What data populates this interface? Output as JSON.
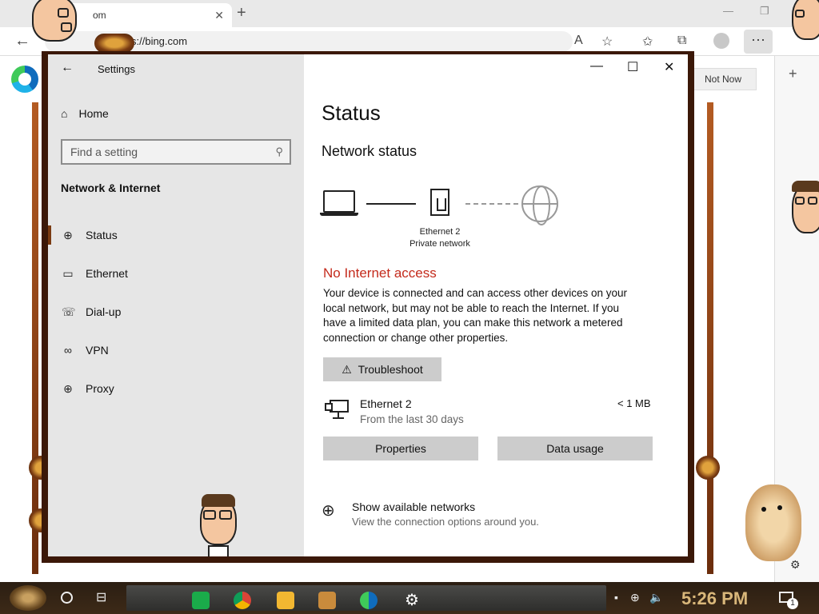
{
  "browser": {
    "tab_title": "om",
    "url": "s://bing.com",
    "not_now_label": "Not Now",
    "more_label": "···"
  },
  "settings": {
    "window_title": "Settings",
    "home_label": "Home",
    "search_placeholder": "Find a setting",
    "section_title": "Network & Internet",
    "nav": [
      {
        "label": "Status",
        "icon": "globe-network-icon",
        "active": true
      },
      {
        "label": "Ethernet",
        "icon": "ethernet-icon"
      },
      {
        "label": "Dial-up",
        "icon": "dialup-icon"
      },
      {
        "label": "VPN",
        "icon": "vpn-icon"
      },
      {
        "label": "Proxy",
        "icon": "proxy-globe-icon"
      }
    ],
    "content": {
      "page_title": "Status",
      "network_status_title": "Network status",
      "network_name": "Ethernet 2",
      "network_type": "Private network",
      "no_internet": "No Internet access",
      "description": "Your device is connected and can access other devices on your local network, but may not be able to reach the Internet. If you have a limited data plan, you can make this network a metered connection or change other properties.",
      "troubleshoot_label": "Troubleshoot",
      "adapter_name": "Ethernet 2",
      "adapter_period": "From the last 30 days",
      "adapter_usage": "< 1 MB",
      "properties_label": "Properties",
      "data_usage_label": "Data usage",
      "show_networks_title": "Show available networks",
      "show_networks_sub": "View the connection options around you."
    }
  },
  "taskbar": {
    "time": "5:26 PM",
    "notification_count": "1"
  },
  "colors": {
    "error_red": "#c42b1c",
    "accent_brown": "#7a3b12",
    "clock_gold": "#d9b77a"
  }
}
